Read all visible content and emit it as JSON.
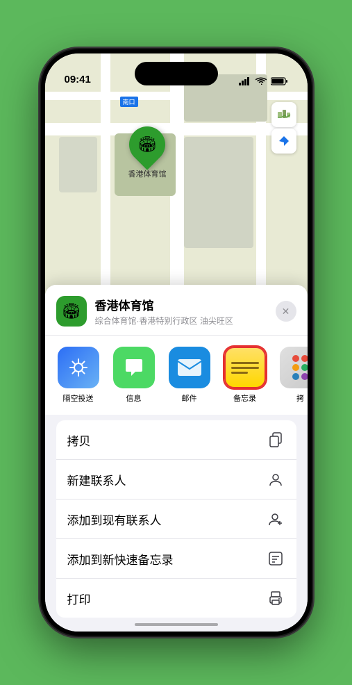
{
  "status_bar": {
    "time": "09:41",
    "signal_bars": "▐▐▐▐",
    "wifi": "wifi",
    "battery": "battery"
  },
  "map": {
    "label": "南口",
    "controls": {
      "map_icon": "🗺",
      "location_icon": "➤"
    }
  },
  "pin": {
    "emoji": "🏟",
    "label": "香港体育馆"
  },
  "location_card": {
    "name": "香港体育馆",
    "subtitle": "综合体育馆·香港特别行政区 油尖旺区",
    "close": "✕"
  },
  "share_items": [
    {
      "id": "airdrop",
      "label": "隔空投送",
      "icon_type": "airdrop"
    },
    {
      "id": "messages",
      "label": "信息",
      "icon_type": "messages"
    },
    {
      "id": "mail",
      "label": "邮件",
      "icon_type": "mail"
    },
    {
      "id": "notes",
      "label": "备忘录",
      "icon_type": "notes"
    },
    {
      "id": "more",
      "label": "拷",
      "icon_type": "more"
    }
  ],
  "actions": [
    {
      "id": "copy",
      "label": "拷贝",
      "icon": "⎘"
    },
    {
      "id": "new-contact",
      "label": "新建联系人",
      "icon": "👤"
    },
    {
      "id": "add-to-contact",
      "label": "添加到现有联系人",
      "icon": "➕"
    },
    {
      "id": "add-note",
      "label": "添加到新快速备忘录",
      "icon": "🖊"
    },
    {
      "id": "print",
      "label": "打印",
      "icon": "🖨"
    }
  ]
}
